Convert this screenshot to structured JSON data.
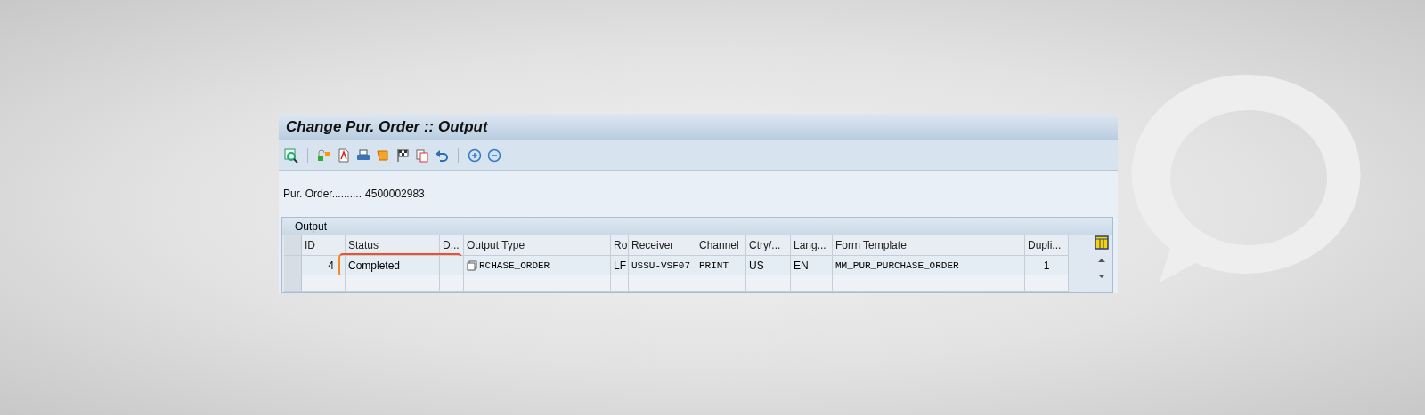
{
  "window": {
    "title": "Change Pur. Order :: Output"
  },
  "header_field": {
    "label": "Pur. Order..........",
    "value": "4500002983"
  },
  "output_panel": {
    "title": "Output",
    "table": {
      "columns": [
        "ID",
        "Status",
        "D...",
        "Output Type",
        "Ro",
        "Receiver",
        "Channel",
        "Ctry/...",
        "Lang...",
        "Form Template",
        "Dupli..."
      ],
      "rows": [
        {
          "selected": false,
          "cells": [
            {
              "text": "4",
              "highlighted": false
            },
            {
              "text": "Completed",
              "highlighted": true
            },
            {
              "text": "",
              "highlighted": false
            },
            {
              "text": "RCHASE_ORDER",
              "highlighted": false
            },
            {
              "text": "LF",
              "highlighted": false
            },
            {
              "text": "USSU-VSF07",
              "highlighted": false
            },
            {
              "text": "PRINT",
              "highlighted": false
            },
            {
              "text": "US",
              "highlighted": false
            },
            {
              "text": "EN",
              "highlighted": false
            },
            {
              "text": "MM_PUR_PURCHASE_ORDER",
              "highlighted": false
            },
            {
              "text": "1",
              "highlighted": false
            }
          ]
        }
      ]
    }
  }
}
